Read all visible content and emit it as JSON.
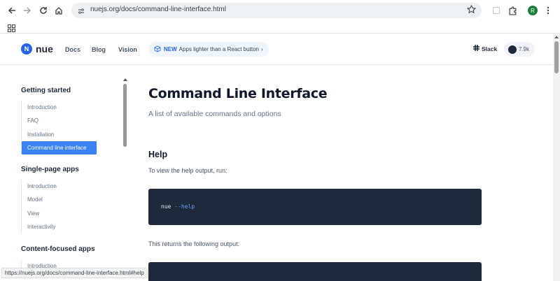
{
  "browser": {
    "url": "nuejs.org/docs/command-line-interface.html",
    "profile_initial": "R",
    "status_url": "https://nuejs.org/docs/command-line-interface.html#help"
  },
  "header": {
    "logo_mark": "N",
    "logo_text": "nue",
    "nav": [
      "Docs",
      "Blog",
      "Vision"
    ],
    "promo": {
      "badge": "NEW",
      "text": "Apps lighter than a React button",
      "chevron": "›"
    },
    "slack_label": "Slack",
    "github_stars": "7.9k"
  },
  "sidebar": {
    "sections": [
      {
        "title": "Getting started",
        "items": [
          "Introduction",
          "FAQ",
          "Installation",
          "Command line interface"
        ],
        "active_index": 3
      },
      {
        "title": "Single-page apps",
        "items": [
          "Introduction",
          "Model",
          "View",
          "Interactivity"
        ]
      },
      {
        "title": "Content-focused apps",
        "items": [
          "Introduction"
        ]
      }
    ]
  },
  "content": {
    "title": "Command Line Interface",
    "lead": "A list of available commands and options",
    "help_heading": "Help",
    "help_intro": "To view the help output, run:",
    "code_cmd": "nue",
    "code_flag": "--help",
    "returns_text": "This returns the following output:"
  },
  "colors": {
    "accent": "#3b82f6",
    "code_bg": "#1e293b",
    "brand": "#2563eb"
  }
}
